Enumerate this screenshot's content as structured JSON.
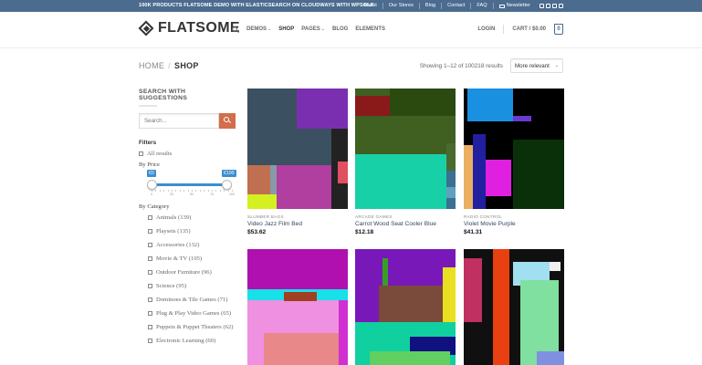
{
  "topbar": {
    "promo": "100K PRODUCTS FLATSOME DEMO WITH ELASTICSEARCH ON CLOUDWAYS WITH WPSOLR",
    "links": [
      "About",
      "Our Stores",
      "Blog",
      "Contact",
      "FAQ"
    ],
    "newsletter": "Newsletter",
    "social_icons": [
      "facebook-icon",
      "instagram-icon",
      "twitter-icon",
      "email-icon"
    ]
  },
  "header": {
    "logo_text": "FLATSOME",
    "nav": {
      "demos": "DEMOS",
      "shop": "SHOP",
      "pages": "PAGES",
      "blog": "BLOG",
      "elements": "ELEMENTS"
    },
    "login": "LOGIN",
    "cart": "CART / $0.00",
    "cart_count": "0"
  },
  "breadcrumb": {
    "home": "HOME",
    "divider": "/",
    "current": "SHOP"
  },
  "result_count": "Showing 1–12 of 100218 results",
  "orderby": "More relevant",
  "sidebar": {
    "search_title": "SEARCH WITH SUGGESTIONS",
    "search_placeholder": "Search...",
    "filters_title": "Filters",
    "all_results": "All results",
    "by_price": "By Price",
    "price_min": "€0",
    "price_max": "€100",
    "price_ticks": [
      "0",
      "25",
      "50",
      "75",
      "100"
    ],
    "by_category": "By Category",
    "categories": [
      {
        "label": "Animals (139)"
      },
      {
        "label": "Playsets (135)"
      },
      {
        "label": "Accessories (132)"
      },
      {
        "label": "Movie & TV (105)"
      },
      {
        "label": "Outdoor Furniture (96)"
      },
      {
        "label": "Science (95)"
      },
      {
        "label": "Dominoes & Tile Games (71)"
      },
      {
        "label": "Plug & Play Video Games (65)"
      },
      {
        "label": "Puppets & Puppet Theaters (62)"
      },
      {
        "label": "Electronic Learning (60)"
      }
    ]
  },
  "products": [
    {
      "category": "SLUMBER BAGS",
      "name": "Video Jazz Film Bed",
      "price": "$53.62",
      "colors": [
        "#3b5060",
        "#7a2fb0",
        "#222222",
        "#b03fa0",
        "#c07050",
        "#d4f020",
        "#8899aa",
        "#e05060"
      ]
    },
    {
      "category": "ARCADE GAMES",
      "name": "Carrot Wood Seat Cooler Blue",
      "price": "$12.18",
      "colors": [
        "#3f6020",
        "#8a1a1a",
        "#2a4a10",
        "#18d0a8",
        "#4a6a30",
        "#3a7090",
        "#60a0c0"
      ]
    },
    {
      "category": "RADIO CONTROL",
      "name": "Violet Movie Purple",
      "price": "$41.31",
      "colors": [
        "#000000",
        "#1a90e0",
        "#6a3ad0",
        "#0a300a",
        "#e8b060",
        "#e020e0",
        "#2020a0"
      ]
    },
    {
      "category": "",
      "name": "",
      "price": "",
      "colors": [
        "#b010b0",
        "#18e0e8",
        "#f090e0",
        "#a04020",
        "#e88888",
        "#d030d0"
      ]
    },
    {
      "category": "",
      "name": "",
      "price": "",
      "colors": [
        "#7818b8",
        "#38a020",
        "#e8e020",
        "#10d0a0",
        "#7a4a3a",
        "#101080",
        "#60d060"
      ]
    },
    {
      "category": "",
      "name": "",
      "price": "",
      "colors": [
        "#101010",
        "#c03060",
        "#e84010",
        "#a0e0f0",
        "#80e0a0",
        "#8090e0",
        "#f0f0f0"
      ]
    }
  ]
}
